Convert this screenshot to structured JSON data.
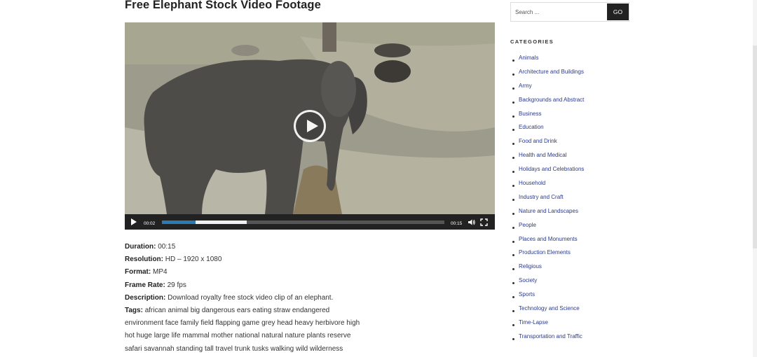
{
  "page": {
    "title": "Free Elephant Stock Video Footage"
  },
  "video": {
    "current_time": "00:02",
    "duration_time": "00:15",
    "played_fraction": 0.12,
    "loaded_fraction": 0.3,
    "accent_color": "#2c7ab3"
  },
  "details": {
    "duration_label": "Duration:",
    "duration_value": " 00:15",
    "resolution_label": "Resolution:",
    "resolution_value": " HD – 1920 x 1080",
    "format_label": "Format:",
    "format_value": " MP4",
    "framerate_label": "Frame Rate:",
    "framerate_value": " 29 fps",
    "description_label": "Description:",
    "description_value": " Download royalty free stock video clip of an elephant.",
    "tags_label": "Tags:",
    "tags_lines": [
      " african animal big dangerous ears eating straw endangered",
      "environment face family field flapping game grey head heavy herbivore high",
      "hot huge large life mammal mother national natural nature plants reserve",
      "safari savannah standing tall travel trunk tusks walking wild wilderness"
    ]
  },
  "sidebar": {
    "search_placeholder": "Search ...",
    "go_label": "GO",
    "categories_heading": "CATEGORIES",
    "categories": [
      "Animals",
      "Architecture and Buildings",
      "Army",
      "Backgrounds and Abstract",
      "Business",
      "Education",
      "Food and Drink",
      "Health and Medical",
      "Holidays and Celebrations",
      "Household",
      "Industry and Craft",
      "Nature and Landscapes",
      "People",
      "Places and Monuments",
      "Production Elements",
      "Religious",
      "Society",
      "Sports",
      "Technology and Science",
      "Time-Lapse",
      "Transportation and Traffic"
    ]
  }
}
